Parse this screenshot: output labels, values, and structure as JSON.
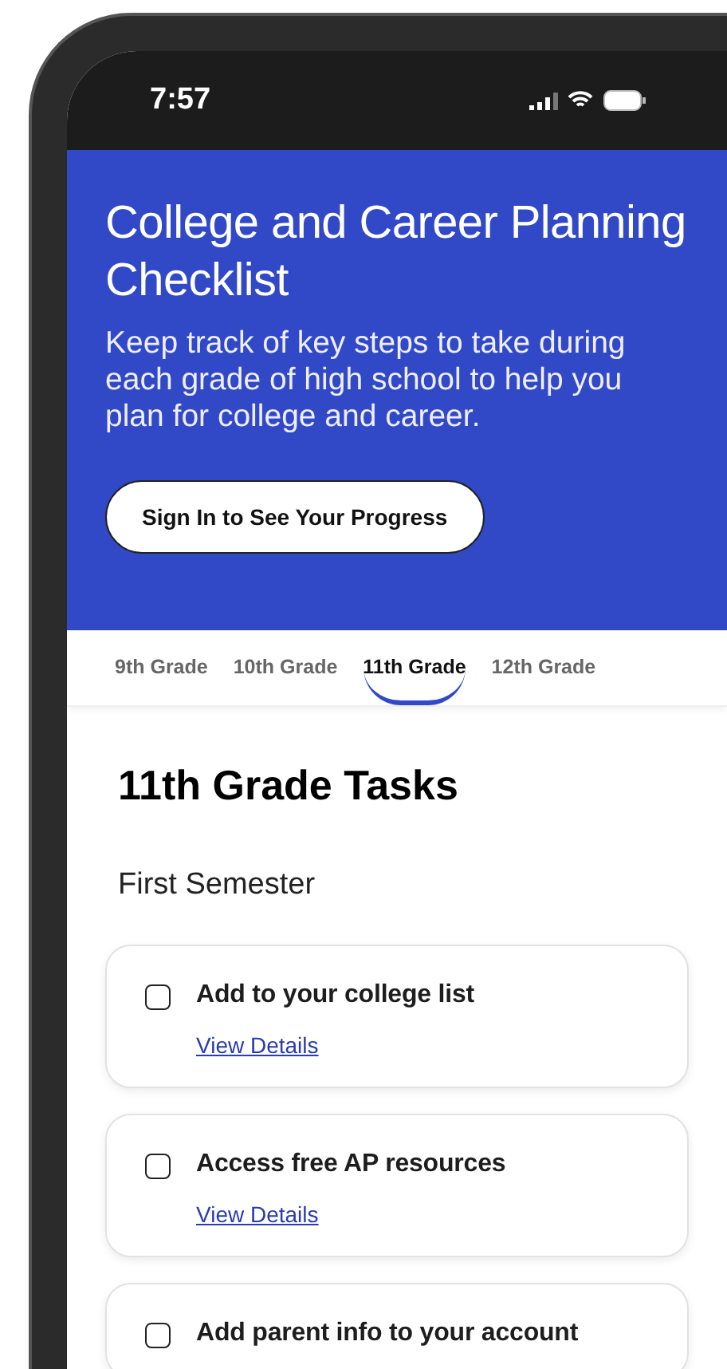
{
  "status_bar": {
    "time": "7:57"
  },
  "header": {
    "title": "College and Career Planning Checklist",
    "description": "Keep track of key steps to take during each grade of high school to help you plan for college and career.",
    "button": "Sign In to See Your Progress"
  },
  "tabs": [
    {
      "label": "9th Grade",
      "selected": false
    },
    {
      "label": "10th Grade",
      "selected": false
    },
    {
      "label": "11th Grade",
      "selected": true
    },
    {
      "label": "12th Grade",
      "selected": false
    }
  ],
  "heading": "11th Grade Tasks",
  "section": "First Semester",
  "tasks": [
    {
      "title": "Add to your college list",
      "checked": false,
      "link": "View Details"
    },
    {
      "title": "Access free AP resources",
      "checked": false,
      "link": "View Details"
    },
    {
      "title": "Add parent info to your account",
      "checked": false
    }
  ]
}
